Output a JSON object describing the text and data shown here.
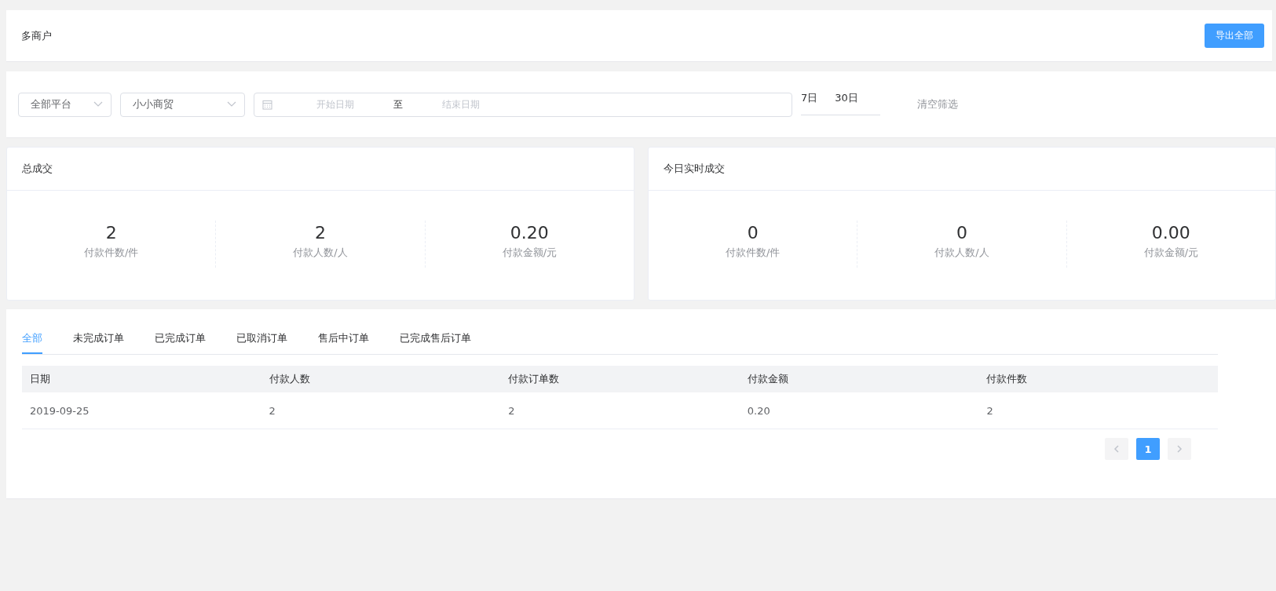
{
  "header": {
    "title": "多商户",
    "export_button": "导出全部"
  },
  "filters": {
    "selects": [
      {
        "value": "全部平台"
      },
      {
        "value": "小小商贸"
      }
    ],
    "date_range": {
      "start_placeholder": "开始日期",
      "separator": "至",
      "end_placeholder": "结束日期"
    },
    "quick_ranges": [
      "7日",
      "30日"
    ],
    "clear_button": "清空筛选"
  },
  "stat_panels": [
    {
      "title": "总成交",
      "metrics": [
        {
          "value": "2",
          "label": "付款件数/件"
        },
        {
          "value": "2",
          "label": "付款人数/人"
        },
        {
          "value": "0.20",
          "label": "付款金额/元"
        }
      ]
    },
    {
      "title": "今日实时成交",
      "metrics": [
        {
          "value": "0",
          "label": "付款件数/件"
        },
        {
          "value": "0",
          "label": "付款人数/人"
        },
        {
          "value": "0.00",
          "label": "付款金额/元"
        }
      ]
    }
  ],
  "tabs": [
    {
      "label": "全部",
      "selected": true
    },
    {
      "label": "未完成订单",
      "selected": false
    },
    {
      "label": "已完成订单",
      "selected": false
    },
    {
      "label": "已取消订单",
      "selected": false
    },
    {
      "label": "售后中订单",
      "selected": false
    },
    {
      "label": "已完成售后订单",
      "selected": false
    }
  ],
  "table": {
    "columns": [
      "日期",
      "付款人数",
      "付款订单数",
      "付款金额",
      "付款件数"
    ],
    "rows": [
      [
        "2019-09-25",
        "2",
        "2",
        "0.20",
        "2"
      ]
    ]
  },
  "pagination": {
    "pages": [
      {
        "label": "1",
        "selected": true
      }
    ]
  }
}
